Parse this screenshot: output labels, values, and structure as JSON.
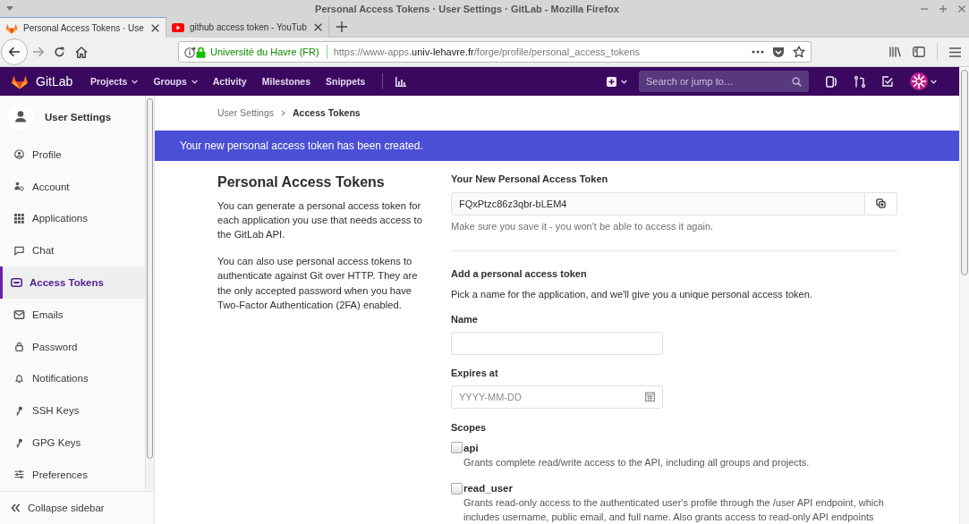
{
  "window": {
    "title": "Personal Access Tokens · User Settings · GitLab - Mozilla Firefox"
  },
  "browser_tabs": [
    {
      "title": "Personal Access Tokens · Use",
      "kind": "gitlab",
      "selected": true
    },
    {
      "title": "github access token - YouTub",
      "kind": "youtube",
      "selected": false
    }
  ],
  "address_bar": {
    "identity": "Université du Havre (FR)",
    "url_start": "https://www-apps.",
    "url_domain": "univ-lehavre.fr",
    "url_path": "/forge/profile/personal_access_tokens"
  },
  "gitlab_header": {
    "brand": "GitLab",
    "links": [
      {
        "label": "Projects",
        "has_menu": true
      },
      {
        "label": "Groups",
        "has_menu": true
      },
      {
        "label": "Activity",
        "has_menu": false
      },
      {
        "label": "Milestones",
        "has_menu": false
      },
      {
        "label": "Snippets",
        "has_menu": false
      }
    ],
    "search": {
      "placeholder": "Search or jump to…"
    }
  },
  "sidebar": {
    "title": "User Settings",
    "items": [
      {
        "label": "Profile",
        "kind": "profile",
        "selected": false
      },
      {
        "label": "Account",
        "kind": "account",
        "selected": false
      },
      {
        "label": "Applications",
        "kind": "applications",
        "selected": false
      },
      {
        "label": "Chat",
        "kind": "chat",
        "selected": false
      },
      {
        "label": "Access Tokens",
        "kind": "access-tokens",
        "selected": true
      },
      {
        "label": "Emails",
        "kind": "emails",
        "selected": false
      },
      {
        "label": "Password",
        "kind": "password",
        "selected": false
      },
      {
        "label": "Notifications",
        "kind": "notifications",
        "selected": false
      },
      {
        "label": "SSH Keys",
        "kind": "ssh-keys",
        "selected": false
      },
      {
        "label": "GPG Keys",
        "kind": "gpg-keys",
        "selected": false
      },
      {
        "label": "Preferences",
        "kind": "preferences",
        "selected": false
      }
    ],
    "collapse": "Collapse sidebar"
  },
  "breadcrumb": [
    {
      "label": "User Settings",
      "kind": "link"
    },
    {
      "label": "Access Tokens",
      "kind": "current"
    }
  ],
  "flash": "Your new personal access token has been created.",
  "intro": {
    "title": "Personal Access Tokens",
    "paragraphs": [
      "You can generate a personal access token for each application you use that needs access to the GitLab API.",
      "You can also use personal access tokens to authenticate against Git over HTTP. They are the only accepted password when you have Two-Factor Authentication (2FA) enabled."
    ]
  },
  "new_token": {
    "label": "Your New Personal Access Token",
    "value": "FQxPtzc86z3qbr-bLEM4",
    "hint": "Make sure you save it - you won't be able to access it again."
  },
  "form": {
    "title": "Add a personal access token",
    "description": "Pick a name for the application, and we'll give you a unique personal access token.",
    "fields": [
      {
        "label": "Name",
        "kind": "text"
      },
      {
        "label": "Expires at",
        "kind": "date",
        "placeholder": "YYYY-MM-DD"
      }
    ],
    "scopes_label": "Scopes",
    "scopes": [
      {
        "name": "api",
        "checked": false,
        "description": "Grants complete read/write access to the API, including all groups and projects."
      },
      {
        "name": "read_user",
        "checked": false,
        "description": "Grants read-only access to the authenticated user's profile through the /user API endpoint, which includes username, public email, and full name. Also grants access to read-only API endpoints"
      }
    ]
  }
}
